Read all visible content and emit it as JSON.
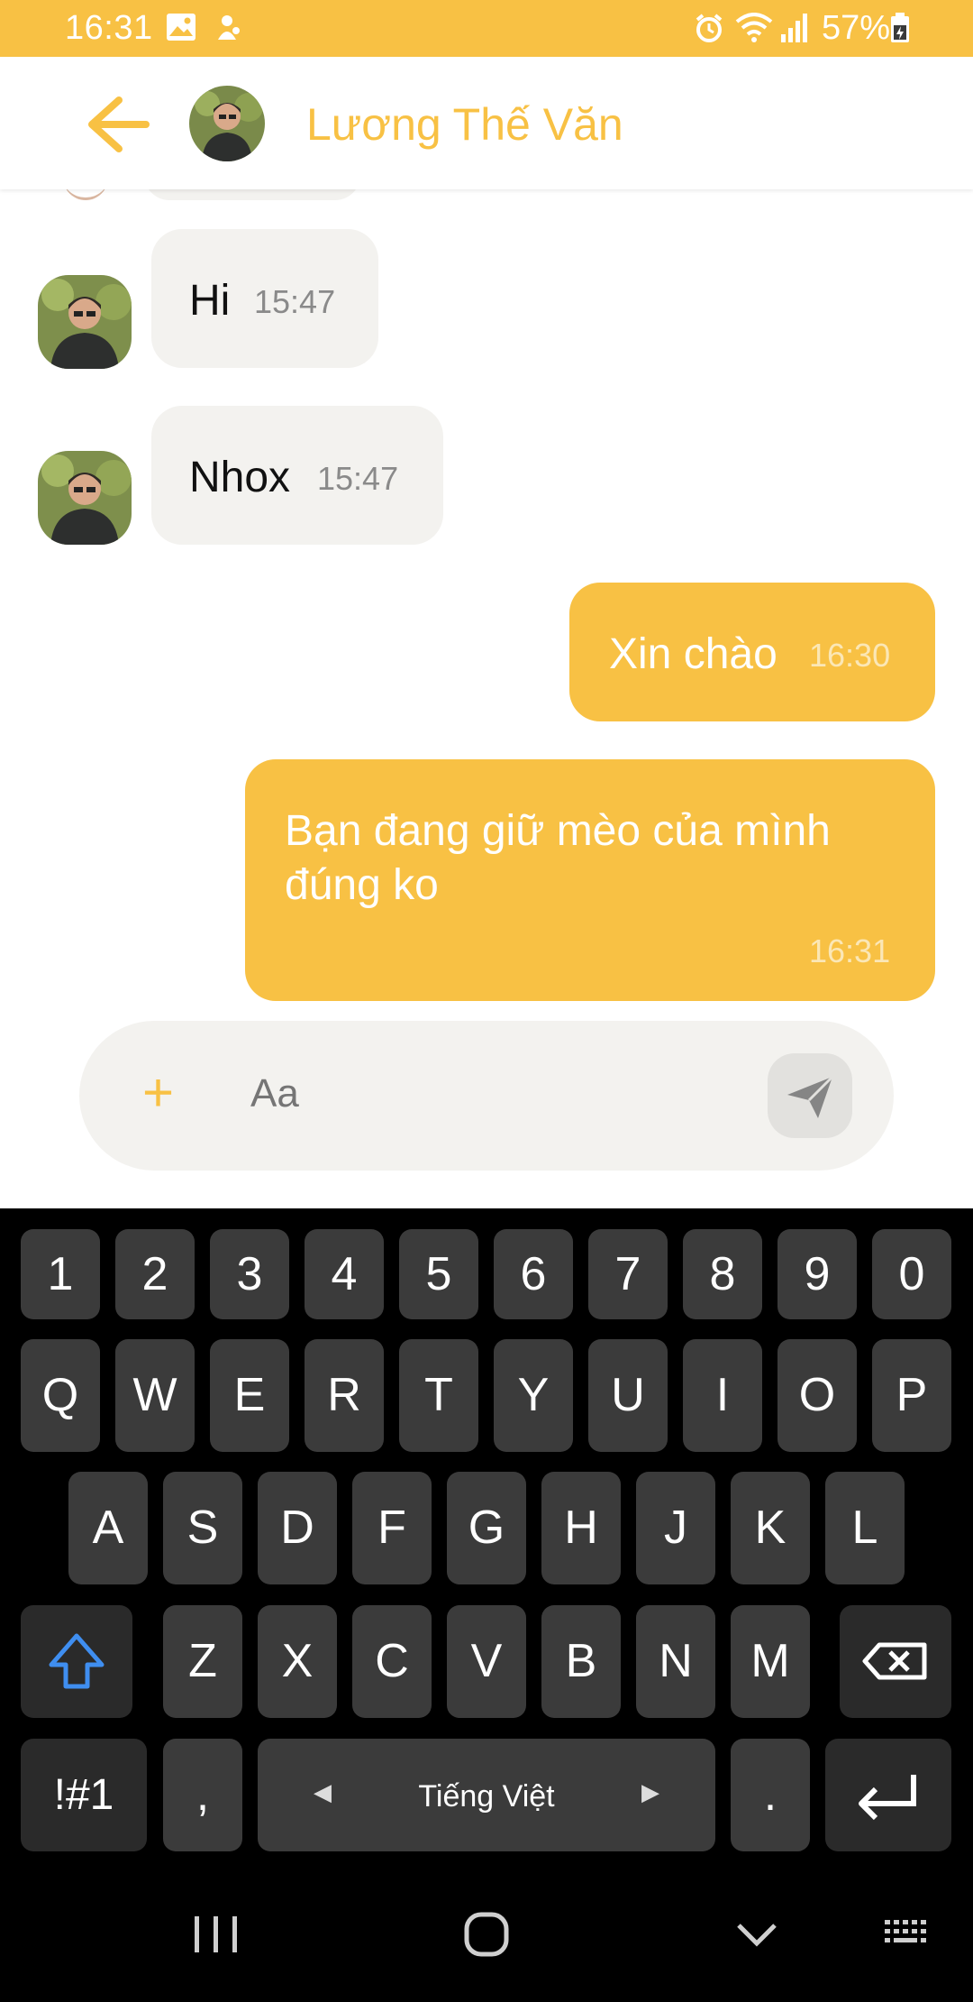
{
  "status_bar": {
    "time": "16:31",
    "battery": "57%",
    "icons": [
      "gallery-icon",
      "notification-icon",
      "alarm-icon",
      "wifi-icon",
      "signal-icon",
      "battery-icon"
    ]
  },
  "header": {
    "title": "Lương Thế Văn",
    "back_icon": "arrow-left-icon"
  },
  "messages": [
    {
      "direction": "incoming",
      "text": "Hi",
      "time": "15:47"
    },
    {
      "direction": "incoming",
      "text": "Nhox",
      "time": "15:47"
    },
    {
      "direction": "outgoing",
      "text": "Xin chào",
      "time": "16:30"
    },
    {
      "direction": "outgoing",
      "text_line1": "Bạn đang giữ mèo của mình",
      "text_line2": "đúng ko",
      "time": "16:31"
    }
  ],
  "composer": {
    "placeholder": "Aa",
    "plus_label": "+",
    "send_icon": "send-icon"
  },
  "keyboard": {
    "number_row": [
      "1",
      "2",
      "3",
      "4",
      "5",
      "6",
      "7",
      "8",
      "9",
      "0"
    ],
    "row1": [
      "Q",
      "W",
      "E",
      "R",
      "T",
      "Y",
      "U",
      "I",
      "O",
      "P"
    ],
    "row2": [
      "A",
      "S",
      "D",
      "F",
      "G",
      "H",
      "J",
      "K",
      "L"
    ],
    "row3": [
      "Z",
      "X",
      "C",
      "V",
      "B",
      "N",
      "M"
    ],
    "symbols_label": "!#1",
    "comma_label": ",",
    "space_label": "Tiếng Việt",
    "period_label": "."
  },
  "colors": {
    "accent": "#f8c144",
    "incoming_bubble": "#f3f2ef",
    "keyboard_bg": "#000000",
    "key_bg": "#3b3b3b",
    "shift_blue": "#3f8ef0"
  }
}
